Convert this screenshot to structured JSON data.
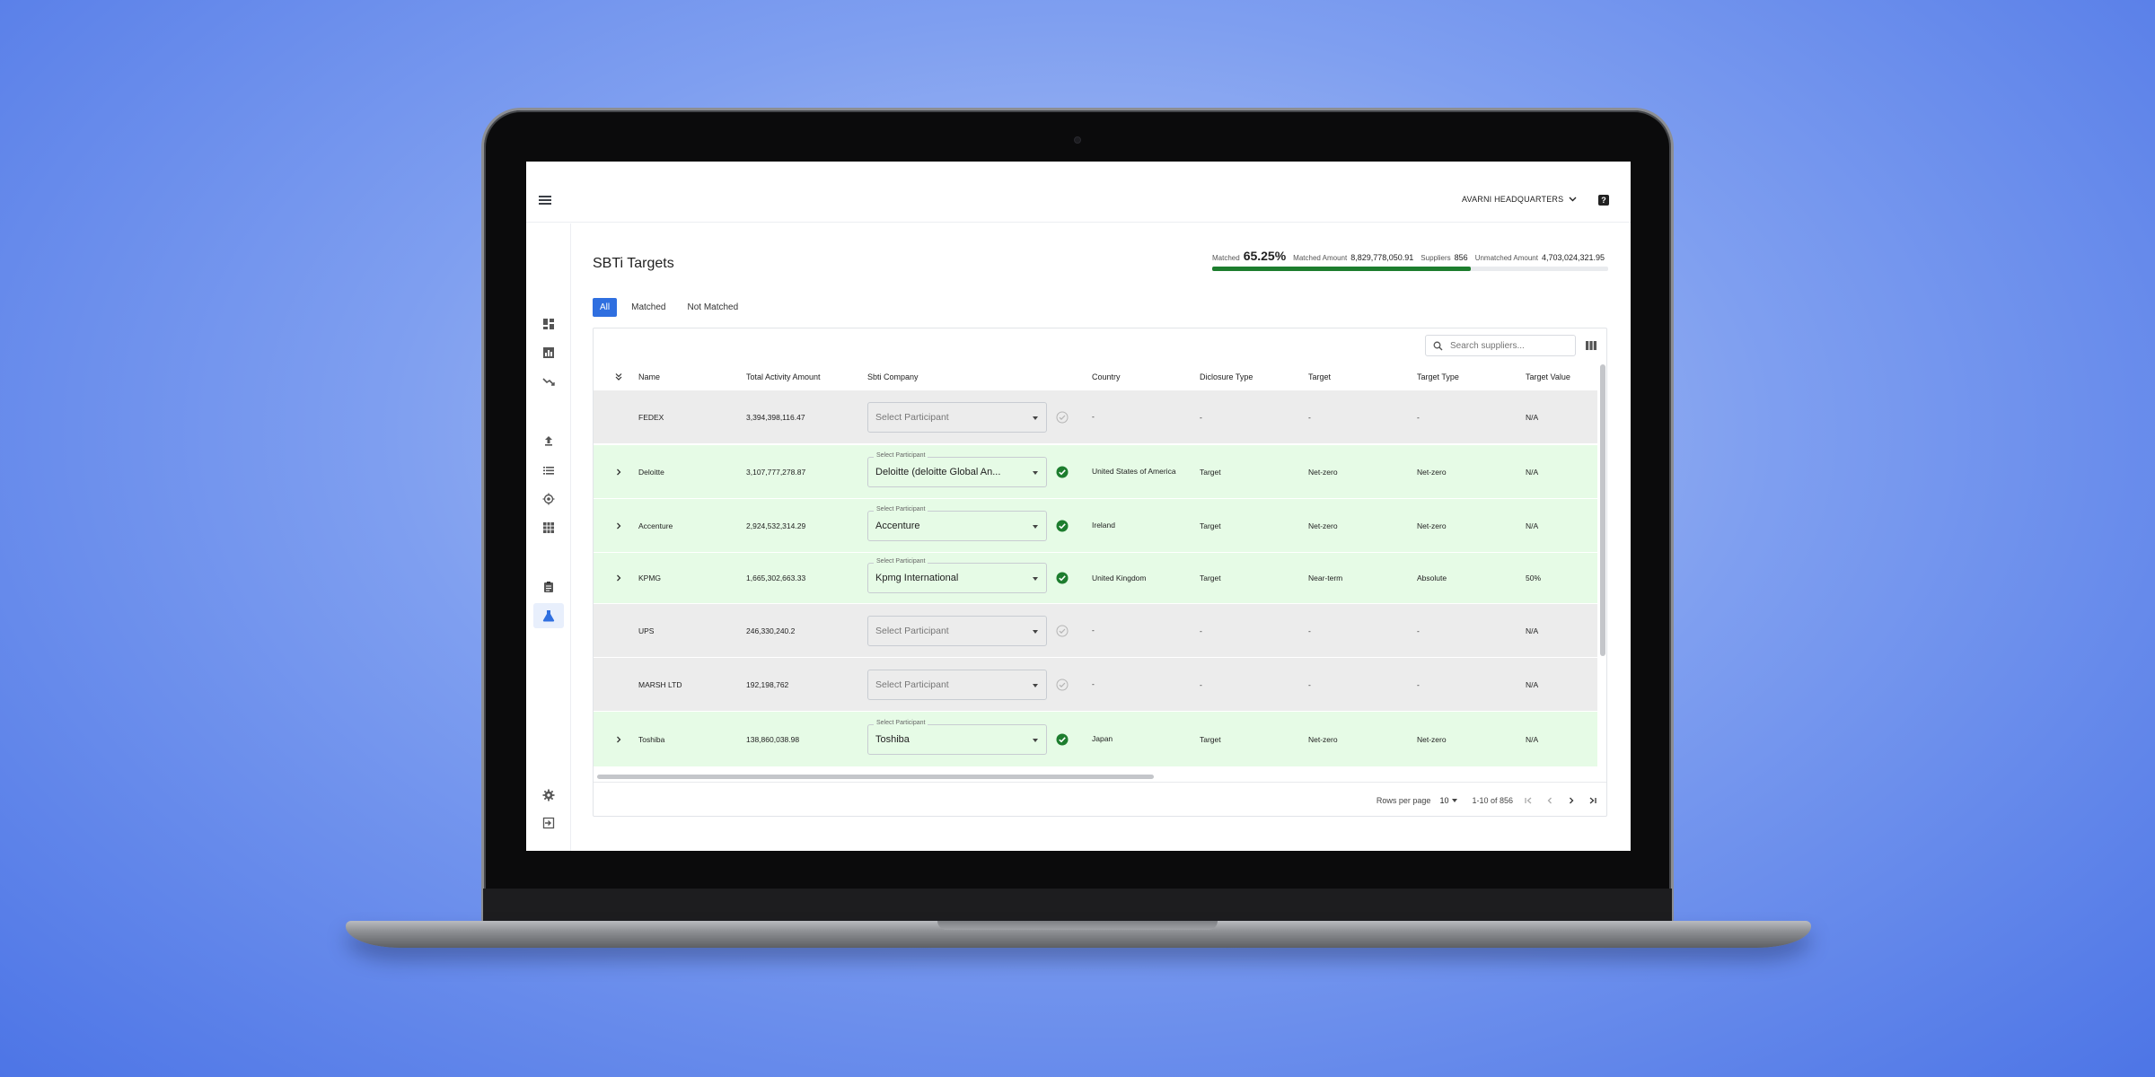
{
  "header": {
    "organization": "AVARNI HEADQUARTERS",
    "help_label": "?"
  },
  "page": {
    "title": "SBTi Targets"
  },
  "stats": {
    "matched_label": "Matched",
    "matched_pct": "65.25%",
    "matched_amount_label": "Matched Amount",
    "matched_amount": "8,829,778,050.91",
    "suppliers_label": "Suppliers",
    "suppliers": "856",
    "unmatched_amount_label": "Unmatched Amount",
    "unmatched_amount": "4,703,024,321.95",
    "progress_fraction": 0.6525,
    "progress_color": "#1d7d2e"
  },
  "tabs": [
    "All",
    "Matched",
    "Not Matched"
  ],
  "search": {
    "placeholder": "Search suppliers..."
  },
  "table": {
    "columns": [
      "Name",
      "Total Activity Amount",
      "Sbti Company",
      "Country",
      "Diclosure Type",
      "Target",
      "Target Type",
      "Target Value"
    ],
    "select_label": "Select Participant",
    "rows": [
      {
        "name": "FEDEX",
        "amount": "3,394,398,116.47",
        "sbti": "Select Participant",
        "matched": false,
        "country": "-",
        "disclosure": "-",
        "target": "-",
        "target_type": "-",
        "target_value": "N/A"
      },
      {
        "name": "Deloitte",
        "amount": "3,107,777,278.87",
        "sbti": "Deloitte (deloitte Global An...",
        "matched": true,
        "country": "United States of America",
        "disclosure": "Target",
        "target": "Net-zero",
        "target_type": "Net-zero",
        "target_value": "N/A"
      },
      {
        "name": "Accenture",
        "amount": "2,924,532,314.29",
        "sbti": "Accenture",
        "matched": true,
        "country": "Ireland",
        "disclosure": "Target",
        "target": "Net-zero",
        "target_type": "Net-zero",
        "target_value": "N/A"
      },
      {
        "name": "KPMG",
        "amount": "1,665,302,663.33",
        "sbti": "Kpmg International",
        "matched": true,
        "country": "United Kingdom",
        "disclosure": "Target",
        "target": "Near-term",
        "target_type": "Absolute",
        "target_value": "50%"
      },
      {
        "name": "UPS",
        "amount": "246,330,240.2",
        "sbti": "Select Participant",
        "matched": false,
        "country": "-",
        "disclosure": "-",
        "target": "-",
        "target_type": "-",
        "target_value": "N/A"
      },
      {
        "name": "MARSH LTD",
        "amount": "192,198,762",
        "sbti": "Select Participant",
        "matched": false,
        "country": "-",
        "disclosure": "-",
        "target": "-",
        "target_type": "-",
        "target_value": "N/A"
      },
      {
        "name": "Toshiba",
        "amount": "138,860,038.98",
        "sbti": "Toshiba",
        "matched": true,
        "country": "Japan",
        "disclosure": "Target",
        "target": "Net-zero",
        "target_type": "Net-zero",
        "target_value": "N/A"
      }
    ]
  },
  "pagination": {
    "rows_per_page_label": "Rows per page",
    "rows_per_page": "10",
    "range": "1-10 of 856"
  },
  "sidebar_icons": [
    "dashboard-icon",
    "analytics-icon",
    "trend-icon",
    "upload-icon",
    "list-icon",
    "target-icon",
    "grid-icon",
    "clipboard-icon",
    "flask-icon",
    "settings-icon",
    "logout-icon"
  ],
  "colors": {
    "accent": "#2f6fe0",
    "matched_row": "#e6fbe6",
    "unmatched_row": "#ececec",
    "check_green": "#1d7d2e"
  }
}
